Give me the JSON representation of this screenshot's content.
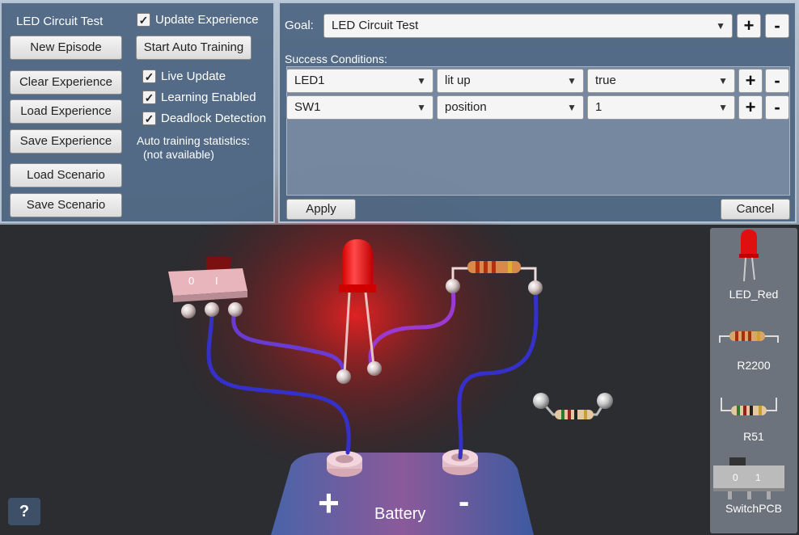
{
  "left_panel": {
    "title": "LED Circuit Test",
    "buttons": {
      "new_episode": "New Episode",
      "clear_experience": "Clear Experience",
      "load_experience": "Load Experience",
      "save_experience": "Save Experience",
      "load_scenario": "Load Scenario",
      "save_scenario": "Save Scenario",
      "start_auto_training": "Start Auto Training"
    },
    "checkboxes": {
      "update_experience": {
        "label": "Update Experience",
        "checked": true
      },
      "live_update": {
        "label": "Live Update",
        "checked": true
      },
      "learning_enabled": {
        "label": "Learning Enabled",
        "checked": true
      },
      "deadlock_detection": {
        "label": "Deadlock Detection",
        "checked": true
      }
    },
    "stats_label": "Auto training statistics:",
    "stats_value": "(not available)"
  },
  "goal_panel": {
    "goal_label": "Goal:",
    "goal_value": "LED Circuit Test",
    "success_label": "Success Conditions:",
    "conditions": [
      {
        "object": "LED1",
        "property": "lit up",
        "value": "true"
      },
      {
        "object": "SW1",
        "property": "position",
        "value": "1"
      }
    ],
    "add_symbol": "+",
    "remove_symbol": "-",
    "apply_label": "Apply",
    "cancel_label": "Cancel"
  },
  "palette": {
    "items": [
      "LED_Red",
      "R2200",
      "R51",
      "SwitchPCB"
    ]
  },
  "scene": {
    "battery_label": "Battery",
    "plus_sign": "+",
    "minus_sign": "-",
    "switch_marks": [
      "0",
      "I"
    ],
    "palette_switch_marks": [
      "0",
      "1"
    ]
  },
  "help_label": "?",
  "colors": {
    "panel_bg": "#4e6682",
    "wire": "#3b36c9",
    "wire_glow": "#9a3ad0",
    "led_red": "#ff1a1a"
  }
}
